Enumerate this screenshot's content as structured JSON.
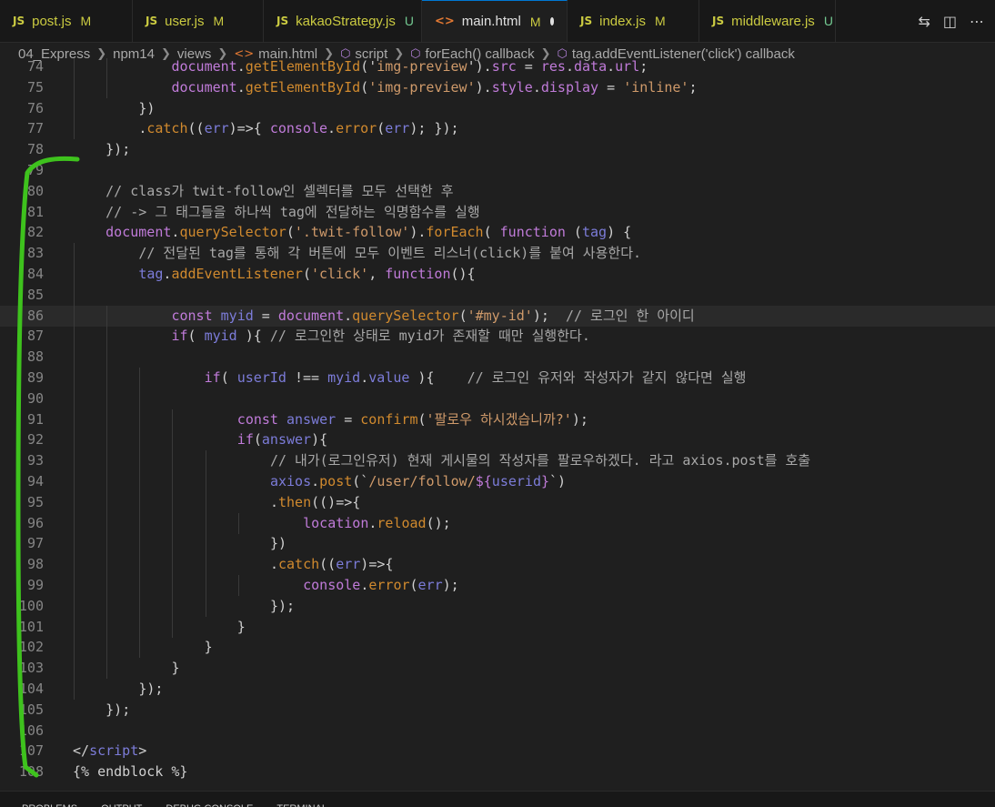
{
  "tabs": [
    {
      "icon": "JS",
      "name": "post.js",
      "status": "M"
    },
    {
      "icon": "JS",
      "name": "user.js",
      "status": "M"
    },
    {
      "icon": "JS",
      "name": "kakaoStrategy.js",
      "status": "U"
    },
    {
      "icon": "<>",
      "name": "main.html",
      "status": "M",
      "active": true
    },
    {
      "icon": "JS",
      "name": "index.js",
      "status": "M"
    },
    {
      "icon": "JS",
      "name": "middleware.js",
      "status": "U"
    }
  ],
  "breadcrumb": [
    "04_Express",
    "npm14",
    "views",
    "main.html",
    "script",
    "forEach() callback",
    "tag.addEventListener('click') callback"
  ],
  "panel_tabs": [
    "PROBLEMS",
    "OUTPUT",
    "DEBUG CONSOLE",
    "TERMINAL"
  ],
  "lines": [
    {
      "n": "74",
      "indent": 5,
      "segs": [
        [
          "document",
          "o-v"
        ],
        [
          ".",
          "o-p"
        ],
        [
          "getElementById",
          "o-fn"
        ],
        [
          "('",
          "o-p"
        ],
        [
          "img-preview",
          "o-s"
        ],
        [
          "').",
          "o-p"
        ],
        [
          "src",
          "o-v"
        ],
        [
          " = ",
          "o-p"
        ],
        [
          "res",
          "o-v"
        ],
        [
          ".",
          "o-p"
        ],
        [
          "data",
          "o-v"
        ],
        [
          ".",
          "o-p"
        ],
        [
          "url",
          "o-v"
        ],
        [
          ";",
          "o-p"
        ]
      ]
    },
    {
      "n": "75",
      "indent": 5,
      "segs": [
        [
          "document",
          "o-v"
        ],
        [
          ".",
          "o-p"
        ],
        [
          "getElementById",
          "o-fn"
        ],
        [
          "(",
          "o-p"
        ],
        [
          "'img-preview'",
          "o-s"
        ],
        [
          ").",
          "o-p"
        ],
        [
          "style",
          "o-v"
        ],
        [
          ".",
          "o-p"
        ],
        [
          "display",
          "o-v"
        ],
        [
          " = ",
          "o-p"
        ],
        [
          "'inline'",
          "o-s"
        ],
        [
          ";",
          "o-p"
        ]
      ]
    },
    {
      "n": "76",
      "indent": 4,
      "segs": [
        [
          "})",
          "o-p"
        ]
      ]
    },
    {
      "n": "77",
      "indent": 4,
      "segs": [
        [
          ".",
          "o-p"
        ],
        [
          "catch",
          "o-fn"
        ],
        [
          "((",
          "o-p"
        ],
        [
          "err",
          "o-k"
        ],
        [
          ")=>{ ",
          "o-p"
        ],
        [
          "console",
          "o-v"
        ],
        [
          ".",
          "o-p"
        ],
        [
          "error",
          "o-fn"
        ],
        [
          "(",
          "o-p"
        ],
        [
          "err",
          "o-k"
        ],
        [
          "); });",
          "o-p"
        ]
      ]
    },
    {
      "n": "78",
      "indent": 3,
      "segs": [
        [
          "});",
          "o-p"
        ]
      ]
    },
    {
      "n": "79",
      "indent": 0,
      "segs": []
    },
    {
      "n": "80",
      "indent": 3,
      "segs": [
        [
          "// class가 twit-follow인 셀렉터를 모두 선택한 후",
          "o-c"
        ]
      ]
    },
    {
      "n": "81",
      "indent": 3,
      "segs": [
        [
          "// -> 그 태그들을 하나씩 tag에 전달하는 익명함수를 실행",
          "o-c"
        ]
      ]
    },
    {
      "n": "82",
      "indent": 3,
      "segs": [
        [
          "document",
          "o-v"
        ],
        [
          ".",
          "o-p"
        ],
        [
          "querySelector",
          "o-fn"
        ],
        [
          "(",
          "o-p"
        ],
        [
          "'.twit-follow'",
          "o-s"
        ],
        [
          ").",
          "o-p"
        ],
        [
          "forEach",
          "o-fn"
        ],
        [
          "( ",
          "o-p"
        ],
        [
          "function",
          "o-v"
        ],
        [
          " (",
          "o-p"
        ],
        [
          "tag",
          "o-k"
        ],
        [
          ") {",
          "o-p"
        ]
      ]
    },
    {
      "n": "83",
      "indent": 4,
      "segs": [
        [
          "// 전달된 tag를 통해 각 버튼에 모두 이벤트 리스너(click)를 붙여 사용한다.",
          "o-c"
        ]
      ]
    },
    {
      "n": "84",
      "indent": 4,
      "segs": [
        [
          "tag",
          "o-k"
        ],
        [
          ".",
          "o-p"
        ],
        [
          "addEventListener",
          "o-fn"
        ],
        [
          "(",
          "o-p"
        ],
        [
          "'click'",
          "o-s"
        ],
        [
          ", ",
          "o-p"
        ],
        [
          "function",
          "o-v"
        ],
        [
          "(){",
          "o-p"
        ]
      ]
    },
    {
      "n": "85",
      "indent": 0,
      "segs": []
    },
    {
      "n": "86",
      "indent": 5,
      "current": true,
      "segs": [
        [
          "const ",
          "o-v"
        ],
        [
          "myid",
          "o-k"
        ],
        [
          " = ",
          "o-p"
        ],
        [
          "document",
          "o-v"
        ],
        [
          ".",
          "o-p"
        ],
        [
          "querySelector",
          "o-fn"
        ],
        [
          "(",
          "o-p"
        ],
        [
          "'#my-id'",
          "o-s"
        ],
        [
          ");  ",
          "o-p"
        ],
        [
          "// 로그인 한 아이디",
          "o-c"
        ]
      ]
    },
    {
      "n": "87",
      "indent": 5,
      "segs": [
        [
          "if",
          "o-v"
        ],
        [
          "( ",
          "o-p"
        ],
        [
          "myid",
          "o-k"
        ],
        [
          " ){ ",
          "o-p"
        ],
        [
          "// 로그인한 상태로 myid가 존재할 때만 실행한다.",
          "o-c"
        ]
      ]
    },
    {
      "n": "88",
      "indent": 0,
      "segs": []
    },
    {
      "n": "89",
      "indent": 6,
      "segs": [
        [
          "if",
          "o-v"
        ],
        [
          "( ",
          "o-p"
        ],
        [
          "userId",
          "o-k"
        ],
        [
          " !== ",
          "o-p"
        ],
        [
          "myid",
          "o-k"
        ],
        [
          ".",
          "o-p"
        ],
        [
          "value",
          "o-k"
        ],
        [
          " ){    ",
          "o-p"
        ],
        [
          "// 로그인 유저와 작성자가 같지 않다면 실행",
          "o-c"
        ]
      ]
    },
    {
      "n": "90",
      "indent": 0,
      "segs": []
    },
    {
      "n": "91",
      "indent": 7,
      "segs": [
        [
          "const ",
          "o-v"
        ],
        [
          "answer",
          "o-k"
        ],
        [
          " = ",
          "o-p"
        ],
        [
          "confirm",
          "o-fn"
        ],
        [
          "(",
          "o-p"
        ],
        [
          "'팔로우 하시겠습니까?'",
          "o-s"
        ],
        [
          ");",
          "o-p"
        ]
      ]
    },
    {
      "n": "92",
      "indent": 7,
      "segs": [
        [
          "if",
          "o-v"
        ],
        [
          "(",
          "o-p"
        ],
        [
          "answer",
          "o-k"
        ],
        [
          "){",
          "o-p"
        ]
      ]
    },
    {
      "n": "93",
      "indent": 8,
      "segs": [
        [
          "// 내가(로그인유저) 현재 게시물의 작성자를 팔로우하겠다. 라고 axios.post를 호출",
          "o-c"
        ]
      ]
    },
    {
      "n": "94",
      "indent": 8,
      "segs": [
        [
          "axios",
          "o-k"
        ],
        [
          ".",
          "o-p"
        ],
        [
          "post",
          "o-fn"
        ],
        [
          "(`",
          "o-p"
        ],
        [
          "/user/follow/",
          "o-s"
        ],
        [
          "${",
          "o-v"
        ],
        [
          "userid",
          "o-k"
        ],
        [
          "}",
          "o-v"
        ],
        [
          "`)",
          "o-p"
        ]
      ]
    },
    {
      "n": "95",
      "indent": 8,
      "segs": [
        [
          ".",
          "o-p"
        ],
        [
          "then",
          "o-fn"
        ],
        [
          "(()=>{",
          "o-p"
        ]
      ]
    },
    {
      "n": "96",
      "indent": 9,
      "segs": [
        [
          "location",
          "o-v"
        ],
        [
          ".",
          "o-p"
        ],
        [
          "reload",
          "o-fn"
        ],
        [
          "();",
          "o-p"
        ]
      ]
    },
    {
      "n": "97",
      "indent": 8,
      "segs": [
        [
          "})",
          "o-p"
        ]
      ]
    },
    {
      "n": "98",
      "indent": 8,
      "segs": [
        [
          ".",
          "o-p"
        ],
        [
          "catch",
          "o-fn"
        ],
        [
          "((",
          "o-p"
        ],
        [
          "err",
          "o-k"
        ],
        [
          ")=>{",
          "o-p"
        ]
      ]
    },
    {
      "n": "99",
      "indent": 9,
      "segs": [
        [
          "console",
          "o-v"
        ],
        [
          ".",
          "o-p"
        ],
        [
          "error",
          "o-fn"
        ],
        [
          "(",
          "o-p"
        ],
        [
          "err",
          "o-k"
        ],
        [
          ");",
          "o-p"
        ]
      ]
    },
    {
      "n": "100",
      "indent": 8,
      "segs": [
        [
          "});",
          "o-p"
        ]
      ]
    },
    {
      "n": "101",
      "indent": 7,
      "segs": [
        [
          "}",
          "o-p"
        ]
      ]
    },
    {
      "n": "102",
      "indent": 6,
      "segs": [
        [
          "}",
          "o-p"
        ]
      ]
    },
    {
      "n": "103",
      "indent": 5,
      "segs": [
        [
          "}",
          "o-p"
        ]
      ]
    },
    {
      "n": "104",
      "indent": 4,
      "segs": [
        [
          "});",
          "o-p"
        ]
      ]
    },
    {
      "n": "105",
      "indent": 3,
      "segs": [
        [
          "});",
          "o-p"
        ]
      ]
    },
    {
      "n": "106",
      "indent": 0,
      "segs": []
    },
    {
      "n": "107",
      "indent": 2,
      "segs": [
        [
          "</",
          "o-p"
        ],
        [
          "script",
          "o-k"
        ],
        [
          ">",
          "o-p"
        ]
      ]
    },
    {
      "n": "108",
      "indent": 2,
      "segs": [
        [
          "{% endblock %}",
          "o-p"
        ]
      ]
    }
  ]
}
